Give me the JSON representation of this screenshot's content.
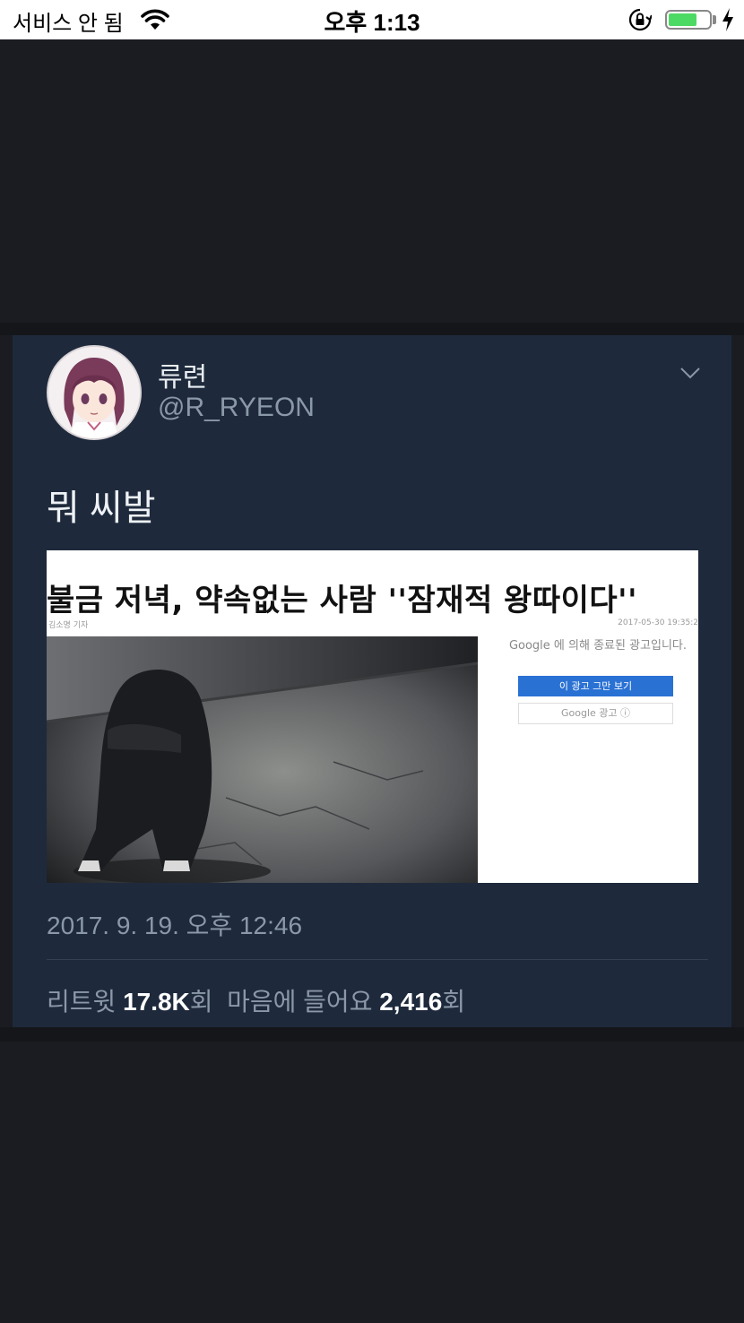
{
  "status_bar": {
    "carrier": "서비스 안 됨",
    "time": "오후 1:13",
    "battery_level": 0.7,
    "battery_color": "#4cd964"
  },
  "tweet": {
    "display_name": "류련",
    "handle": "@R_RYEON",
    "text": "뭐 씨발",
    "media": {
      "headline": "불금 저녁, 약속없는 사람 ''잠재적 왕따이다''",
      "byline": "김소명 기자",
      "dateline": "2017-05-30 19:35:2",
      "ad_text": "Google 에 의해 종료된 광고입니다.",
      "ad_button_primary": "이 광고 그만 보기",
      "ad_button_secondary": "Google 광고 ⓘ"
    },
    "timestamp": "2017. 9. 19. 오후 12:46",
    "stats": {
      "retweet_label": "리트윗",
      "retweet_count": "17.8K",
      "retweet_suffix": "회",
      "like_label": "마음에 들어요",
      "like_count": "2,416",
      "like_suffix": "회"
    }
  },
  "colors": {
    "background": "#1b1c22",
    "card": "#1e2a3c",
    "secondary_text": "#8b98a8",
    "ad_blue": "#2a71d4"
  }
}
